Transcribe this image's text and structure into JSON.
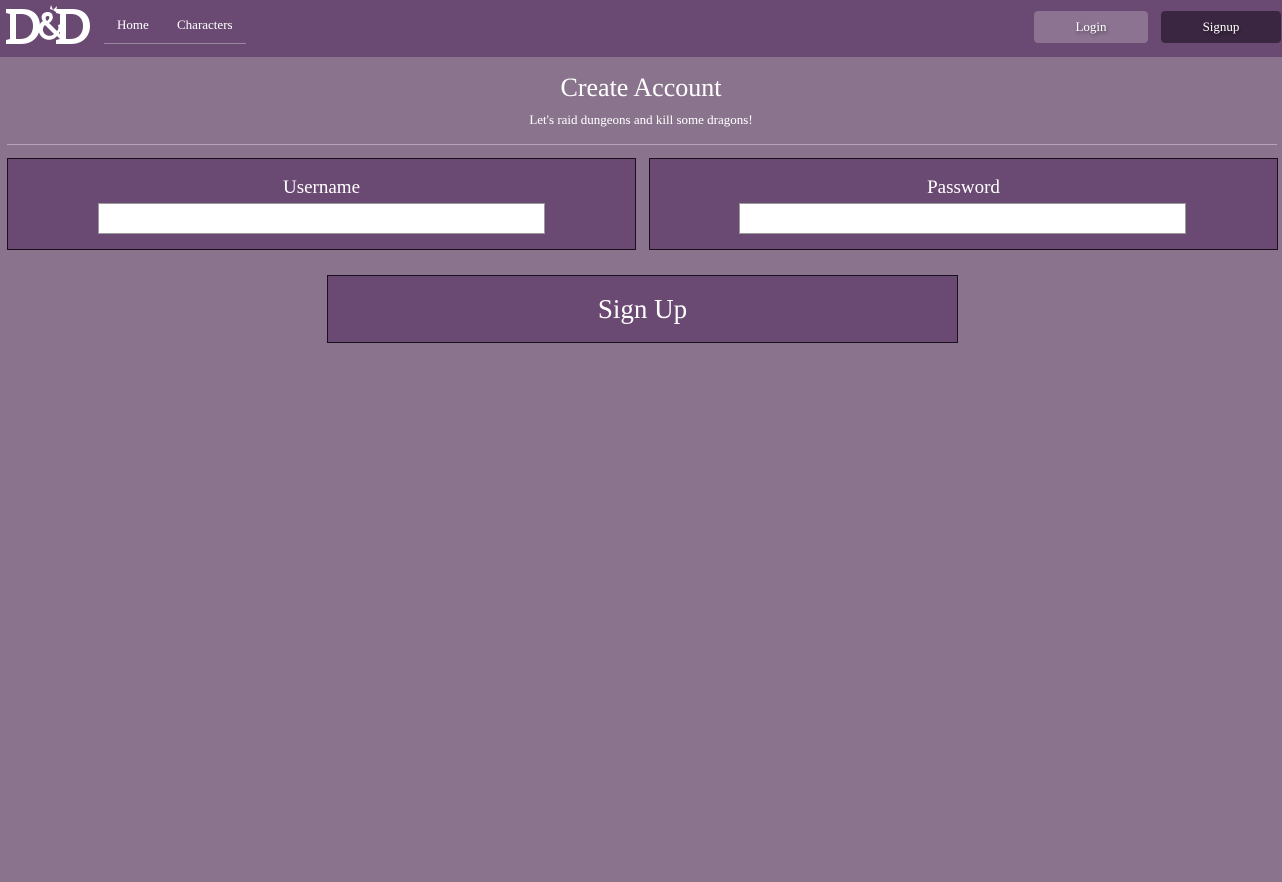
{
  "navbar": {
    "logo_text": "D&D",
    "links": [
      {
        "label": "Home"
      },
      {
        "label": "Characters"
      }
    ],
    "login_label": "Login",
    "signup_label": "Signup"
  },
  "main": {
    "title": "Create Account",
    "subtitle": "Let's raid dungeons and kill some dragons!",
    "fields": {
      "username": {
        "label": "Username",
        "value": "",
        "placeholder": ""
      },
      "password": {
        "label": "Password",
        "value": "",
        "placeholder": ""
      }
    },
    "submit_label": "Sign Up"
  },
  "colors": {
    "page_background": "#8a738d",
    "navbar_background": "#6a4972",
    "panel_background": "#6a4972",
    "login_button": "#8c7392",
    "signup_button": "#3a2640",
    "text": "#ffffff"
  },
  "icons": {
    "logo": "dungeons-and-dragons-logo"
  }
}
